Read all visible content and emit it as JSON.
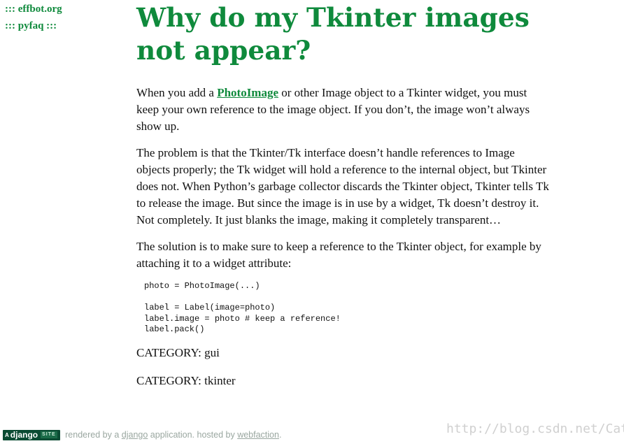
{
  "nav": {
    "links": [
      "::: effbot.org",
      "::: pyfaq :::"
    ]
  },
  "article": {
    "title_line1": "Why do my Tkinter images",
    "title_line2": "not appear?",
    "p1_before": "When you add a ",
    "p1_link": "PhotoImage",
    "p1_after": " or other Image object to a Tkinter widget, you must keep your own reference to the image object. If you don’t, the image won’t always show up.",
    "p2": "The problem is that the Tkinter/Tk interface doesn’t handle references to Image objects properly; the Tk widget will hold a reference to the internal object, but Tkinter does not. When Python’s garbage collector discards the Tkinter object, Tkinter tells Tk to release the image. But since the image is in use by a widget, Tk doesn’t destroy it. Not completely. It just blanks the image, making it completely transparent…",
    "p3": "The solution is to make sure to keep a reference to the Tkinter object, for example by attaching it to a widget attribute:",
    "code_lines": [
      "photo = PhotoImage(...)",
      "",
      "label = Label(image=photo)",
      "label.image = photo # keep a reference!",
      "label.pack()"
    ],
    "categories": [
      "CATEGORY: gui",
      "CATEGORY: tkinter"
    ]
  },
  "footer": {
    "badge_a": "A",
    "badge_django": "django",
    "badge_site": "SITE",
    "text1": " rendered by a ",
    "link_django": "django",
    "text2": " application. hosted by ",
    "link_webfaction": "webfaction",
    "text3": "."
  },
  "watermark": "http://blog.csdn.net/Cat",
  "colors": {
    "accent_green": "#0f8a3c",
    "badge_bg": "#0b4b33",
    "footer_gray": "#9aa7a0",
    "watermark_gray": "#d0d0d0"
  }
}
